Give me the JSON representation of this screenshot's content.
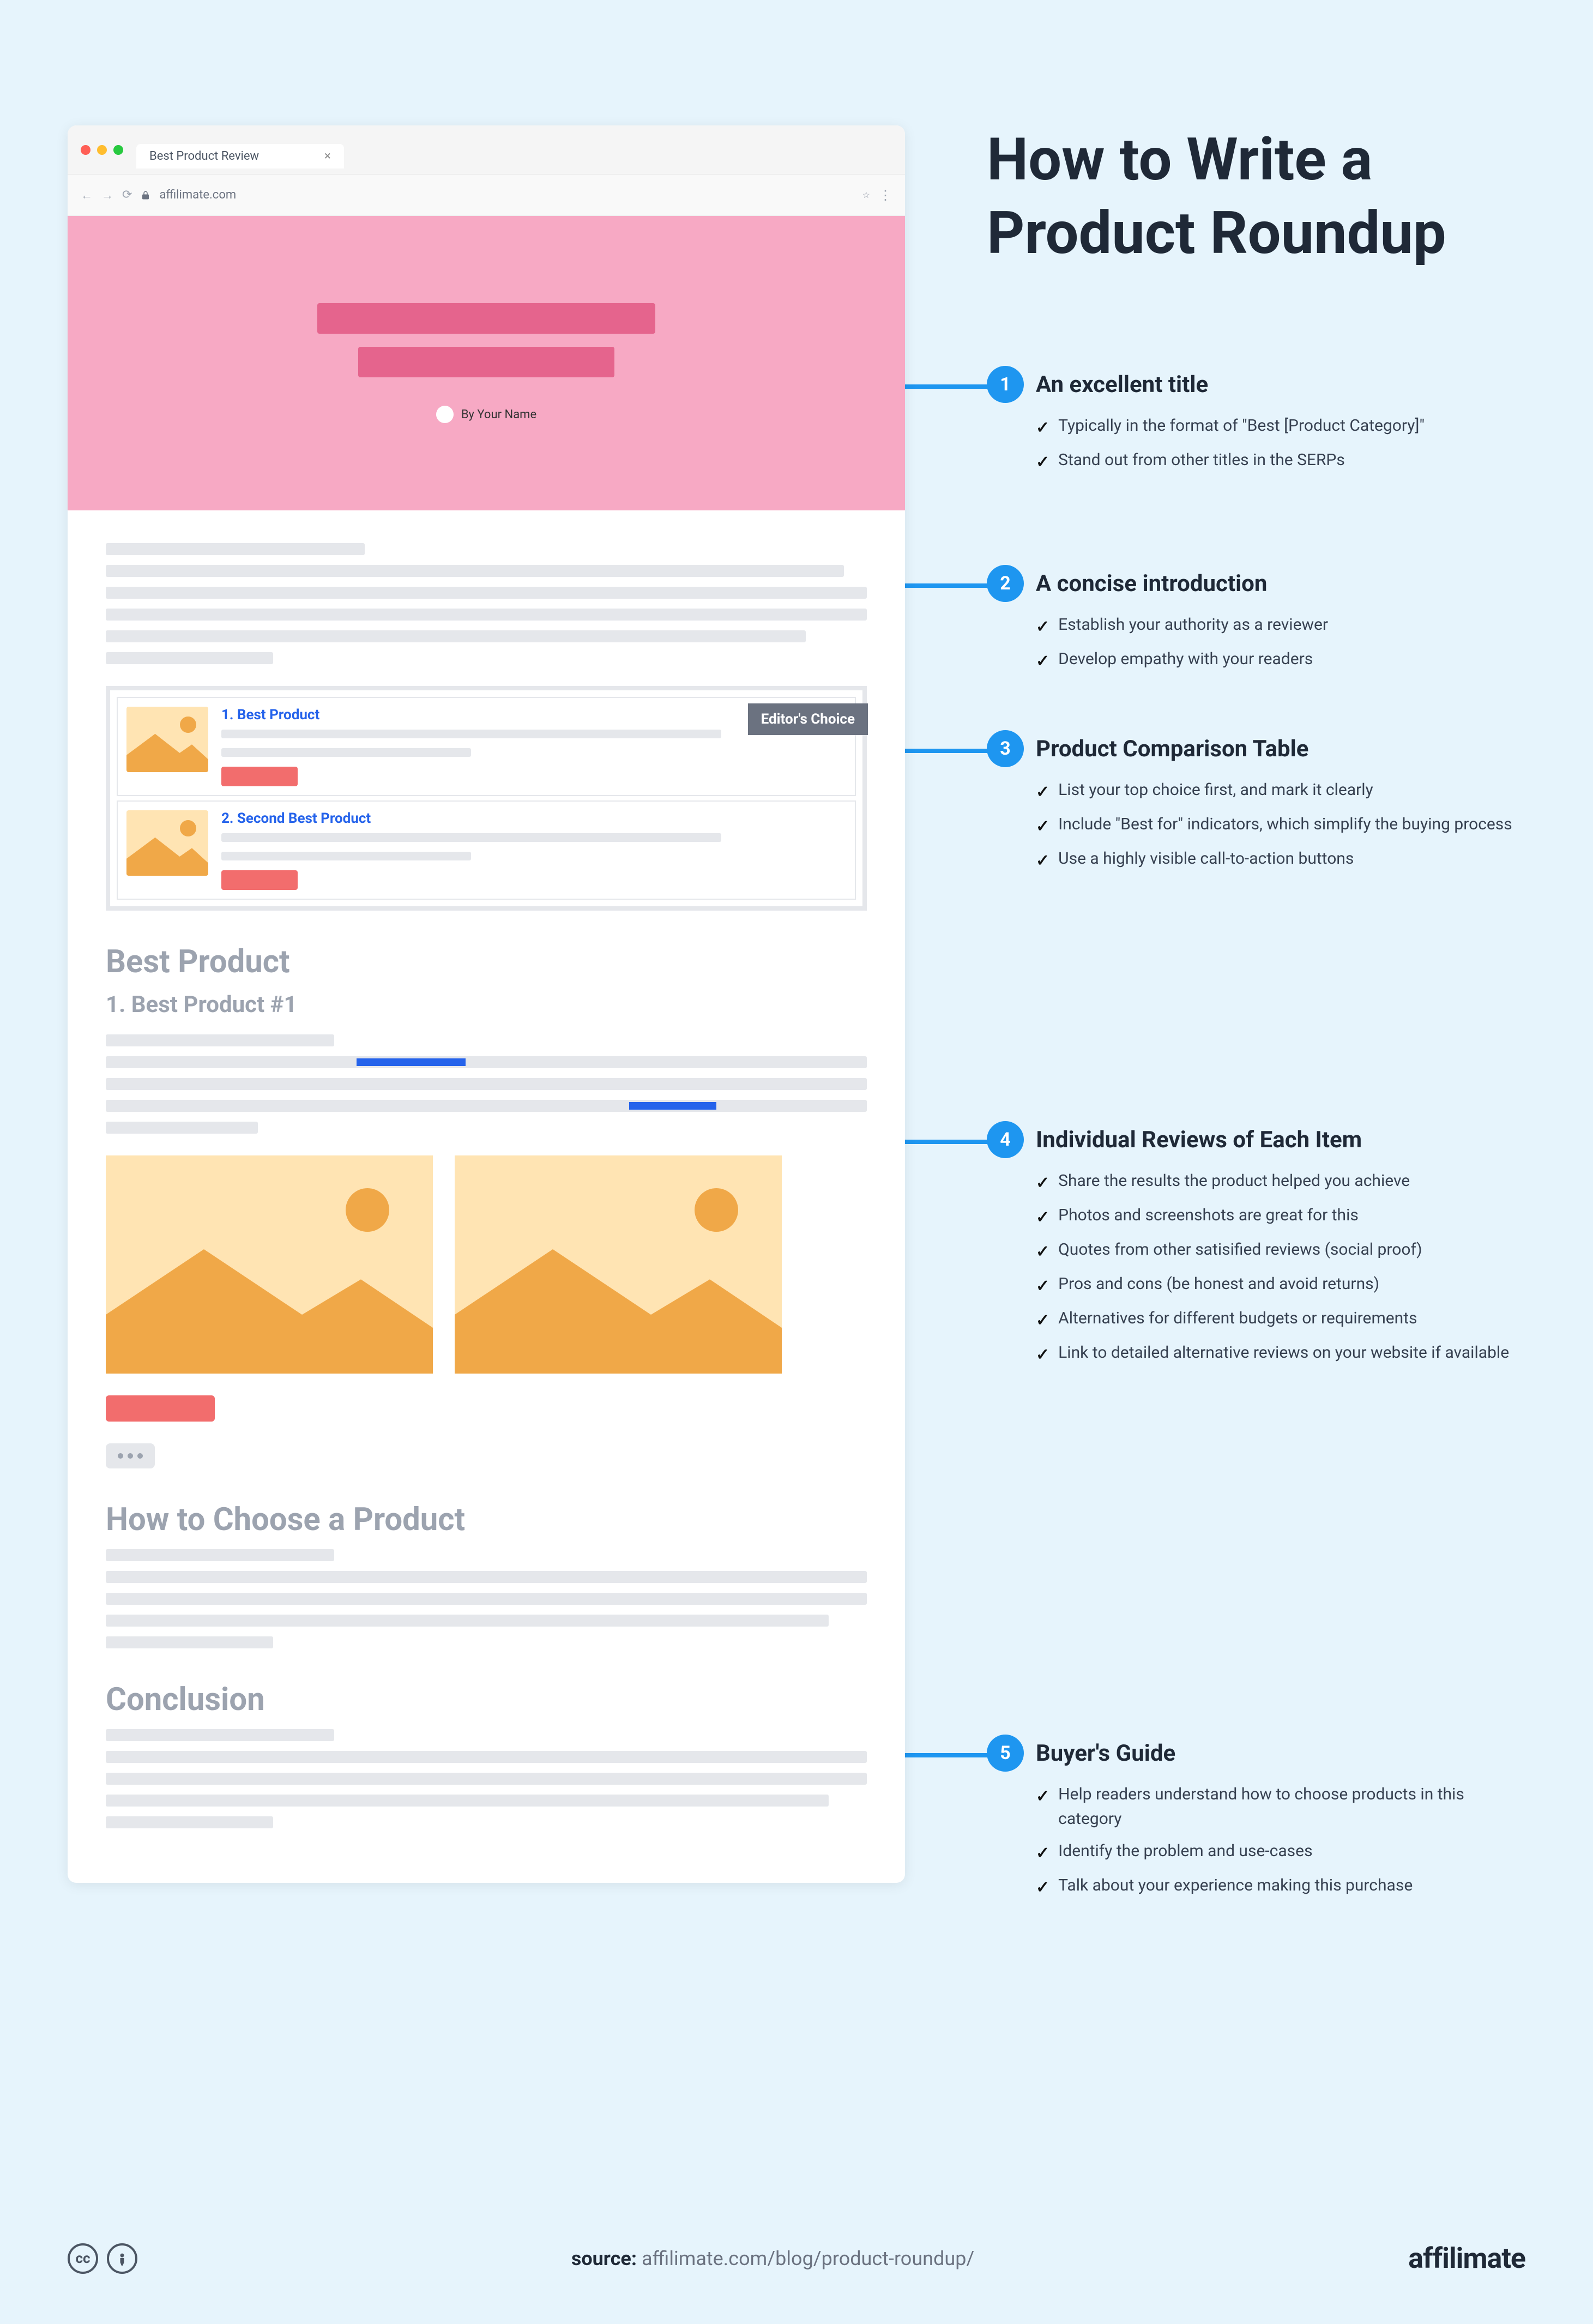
{
  "title_line1": "How to Write a",
  "title_line2": "Product Roundup",
  "browser": {
    "tab_title": "Best Product Review",
    "url": "affilimate.com"
  },
  "hero": {
    "byline": "By Your Name"
  },
  "comparison": {
    "item1": "1. Best Product",
    "item2": "2. Second Best Product",
    "badge": "Editor's Choice"
  },
  "sections": {
    "best": "Best Product",
    "best_sub": "1.  Best Product #1",
    "choose": "How to Choose a Product",
    "conclusion": "Conclusion"
  },
  "annotations": [
    {
      "num": "1",
      "title": "An excellent title",
      "items": [
        "Typically in the format of \"Best [Product Category]\"",
        "Stand out from other titles in the SERPs"
      ]
    },
    {
      "num": "2",
      "title": "A concise introduction",
      "items": [
        "Establish your authority as a reviewer",
        "Develop empathy with your readers"
      ]
    },
    {
      "num": "3",
      "title": "Product Comparison Table",
      "items": [
        "List your top choice first, and mark it clearly",
        "Include \"Best for\" indicators, which simplify the buying process",
        "Use a highly visible call-to-action buttons"
      ]
    },
    {
      "num": "4",
      "title": "Individual Reviews of Each Item",
      "items": [
        "Share the results the product helped you achieve",
        "Photos and screenshots are great for this",
        "Quotes from other satisified reviews (social proof)",
        "Pros and cons (be honest and avoid returns)",
        "Alternatives for different budgets or requirements",
        "Link to detailed alternative reviews on your website if available"
      ]
    },
    {
      "num": "5",
      "title": "Buyer's Guide",
      "items": [
        "Help readers understand how to choose products in this category",
        "Identify the problem and use-cases",
        "Talk about your experience making this purchase"
      ]
    }
  ],
  "footer": {
    "source_label": "source:",
    "source_url": "affilimate.com/blog/product-roundup/",
    "brand": "affilimate"
  }
}
